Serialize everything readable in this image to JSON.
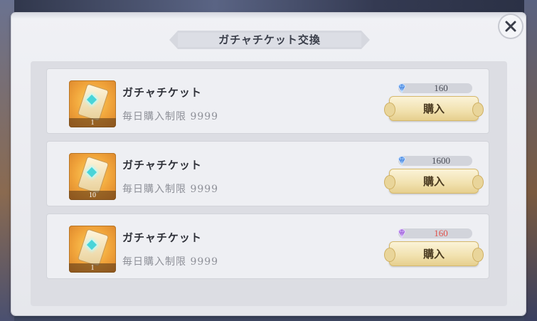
{
  "dialog": {
    "title": "ガチャチケット交換"
  },
  "items": [
    {
      "name": "ガチャチケット",
      "limit": "毎日購入制限 9999",
      "quantity": "1",
      "price": "160",
      "currency_icon": "blue-diamond-icon",
      "price_color": "#4b4e58",
      "buy_label": "購入"
    },
    {
      "name": "ガチャチケット",
      "limit": "毎日購入制限 9999",
      "quantity": "10",
      "price": "1600",
      "currency_icon": "blue-diamond-icon",
      "price_color": "#4b4e58",
      "buy_label": "購入"
    },
    {
      "name": "ガチャチケット",
      "limit": "毎日購入制限 9999",
      "quantity": "1",
      "price": "160",
      "currency_icon": "purple-diamond-icon",
      "price_color": "#e0504a",
      "buy_label": "購入"
    }
  ],
  "colors": {
    "blue_gem": "#3b7ddd",
    "purple_gem": "#9a5ad6",
    "price_red": "#e0504a"
  }
}
